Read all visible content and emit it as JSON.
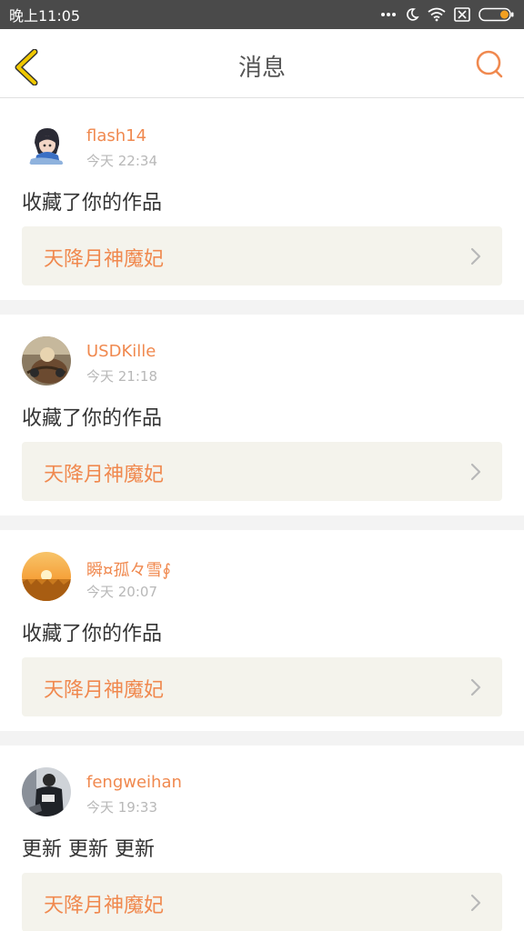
{
  "status_bar": {
    "time": "晚上11:05",
    "icons": [
      "more-dots-icon",
      "moon-icon",
      "wifi-icon",
      "sim-off-icon",
      "battery-icon"
    ]
  },
  "header": {
    "title": "消息",
    "back_icon": "chevron-left-icon",
    "search_icon": "search-icon",
    "accent_color": "#f0c800",
    "search_color": "#f0894f"
  },
  "colors": {
    "name": "#f0894f",
    "time": "#b8b8b8",
    "link_bg": "#f4f3ec"
  },
  "messages": [
    {
      "user": "flash14",
      "time": "今天 22:34",
      "action": "收藏了你的作品",
      "work": "天降月神魔妃",
      "avatar": "anime-avatar"
    },
    {
      "user": "USDKille",
      "time": "今天 21:18",
      "action": "收藏了你的作品",
      "work": "天降月神魔妃",
      "avatar": "photo-avatar"
    },
    {
      "user": "瞬¤孤々雪∮",
      "time": "今天 20:07",
      "action": "收藏了你的作品",
      "work": "天降月神魔妃",
      "avatar": "sunset-avatar"
    },
    {
      "user": "fengweihan",
      "time": "今天 19:33",
      "action": "更新 更新 更新",
      "work": "天降月神魔妃",
      "avatar": "person-avatar"
    }
  ]
}
